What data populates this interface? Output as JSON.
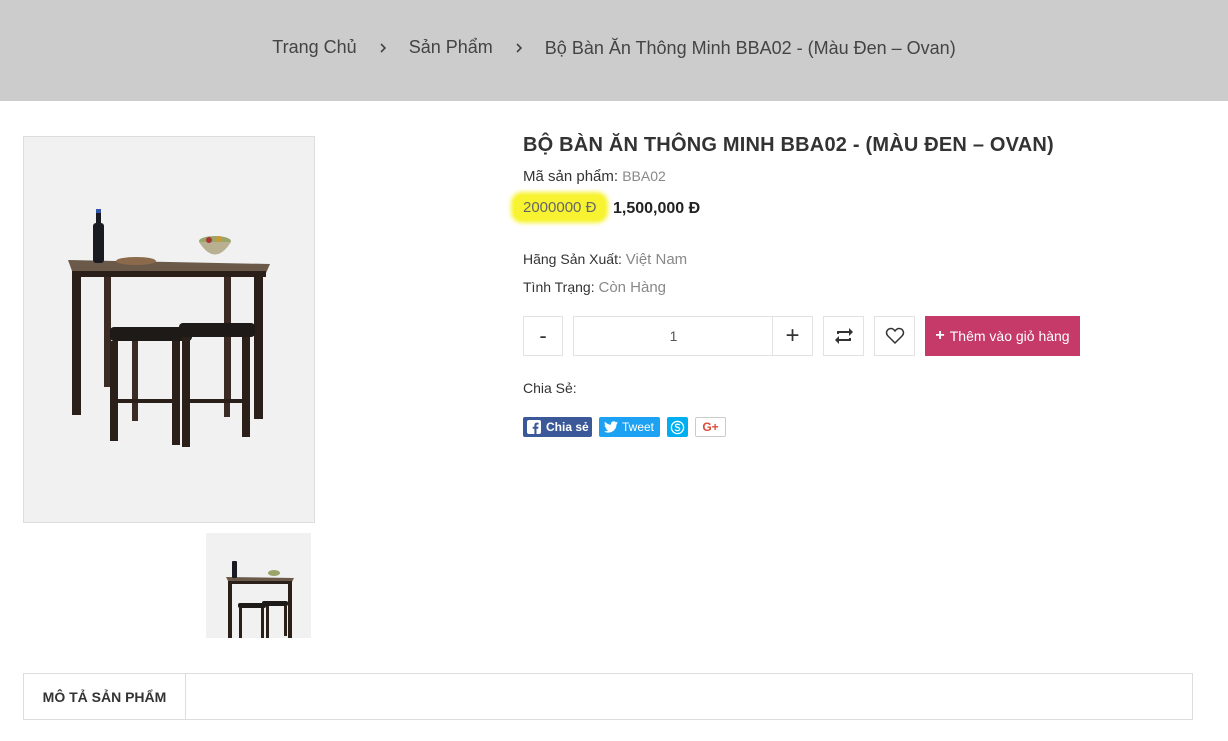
{
  "breadcrumb": {
    "home": "Trang Chủ",
    "products": "Sản Phẩm",
    "current": "Bộ Bàn Ăn Thông Minh BBA02 - (Màu Đen – Ovan)"
  },
  "product": {
    "title": "BỘ BÀN ĂN THÔNG MINH BBA02 - (MÀU ĐEN – OVAN)",
    "sku_label": "Mã sản phẩm:",
    "sku_value": "BBA02",
    "old_price": "2000000 Đ",
    "new_price": "1,500,000 Đ",
    "maker_label": "Hãng Sản Xuất:",
    "maker_value": "Việt Nam",
    "status_label": "Tình Trạng:",
    "status_value": "Còn Hàng"
  },
  "cart": {
    "minus": "-",
    "quantity": "1",
    "plus": "+",
    "add_icon": "+",
    "add_label": "Thêm vào giỏ hàng"
  },
  "share": {
    "label": "Chia Sẻ:",
    "facebook": "Chia sẻ",
    "twitter": "Tweet",
    "gplus": "G+"
  },
  "tabs": {
    "description": "MÔ TẢ SẢN PHẨM"
  },
  "colors": {
    "breadcrumb_bg": "#cccccc",
    "accent": "#c53a68",
    "highlight": "#f8f330",
    "facebook": "#3b5998",
    "twitter": "#1da1f2",
    "skype": "#00aff0"
  },
  "icons": [
    "chevron-right-icon",
    "refresh-icon",
    "heart-icon",
    "facebook-icon",
    "twitter-icon",
    "skype-icon"
  ]
}
